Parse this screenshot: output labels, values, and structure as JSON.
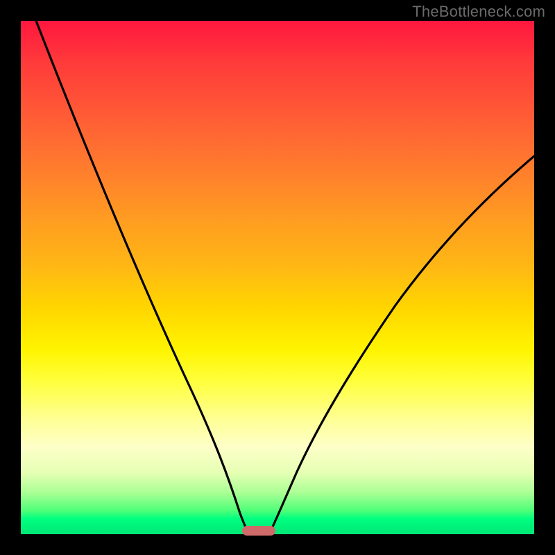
{
  "watermark": "TheBottleneck.com",
  "chart_data": {
    "type": "line",
    "title": "",
    "xlabel": "",
    "ylabel": "",
    "xlim": [
      0,
      100
    ],
    "ylim": [
      0,
      100
    ],
    "grid": false,
    "legend": false,
    "series": [
      {
        "name": "left-curve",
        "x": [
          3,
          10,
          18,
          25,
          30,
          34,
          37,
          39.5,
          41.5,
          43,
          44
        ],
        "y": [
          100,
          80,
          60,
          42,
          30,
          20,
          12,
          6,
          2.5,
          0.8,
          0
        ]
      },
      {
        "name": "right-curve",
        "x": [
          48,
          50,
          53,
          57,
          62,
          68,
          75,
          83,
          91,
          100
        ],
        "y": [
          0,
          1.5,
          5,
          11,
          19,
          29,
          40,
          52,
          63,
          74
        ]
      }
    ],
    "marker": {
      "name": "optimal-range-marker",
      "x_center": 46,
      "width": 6,
      "y": 0,
      "color": "#cf6a6a"
    },
    "background_gradient": {
      "top": "#ff173f",
      "mid": "#ffe000",
      "bottom": "#00e676"
    }
  }
}
